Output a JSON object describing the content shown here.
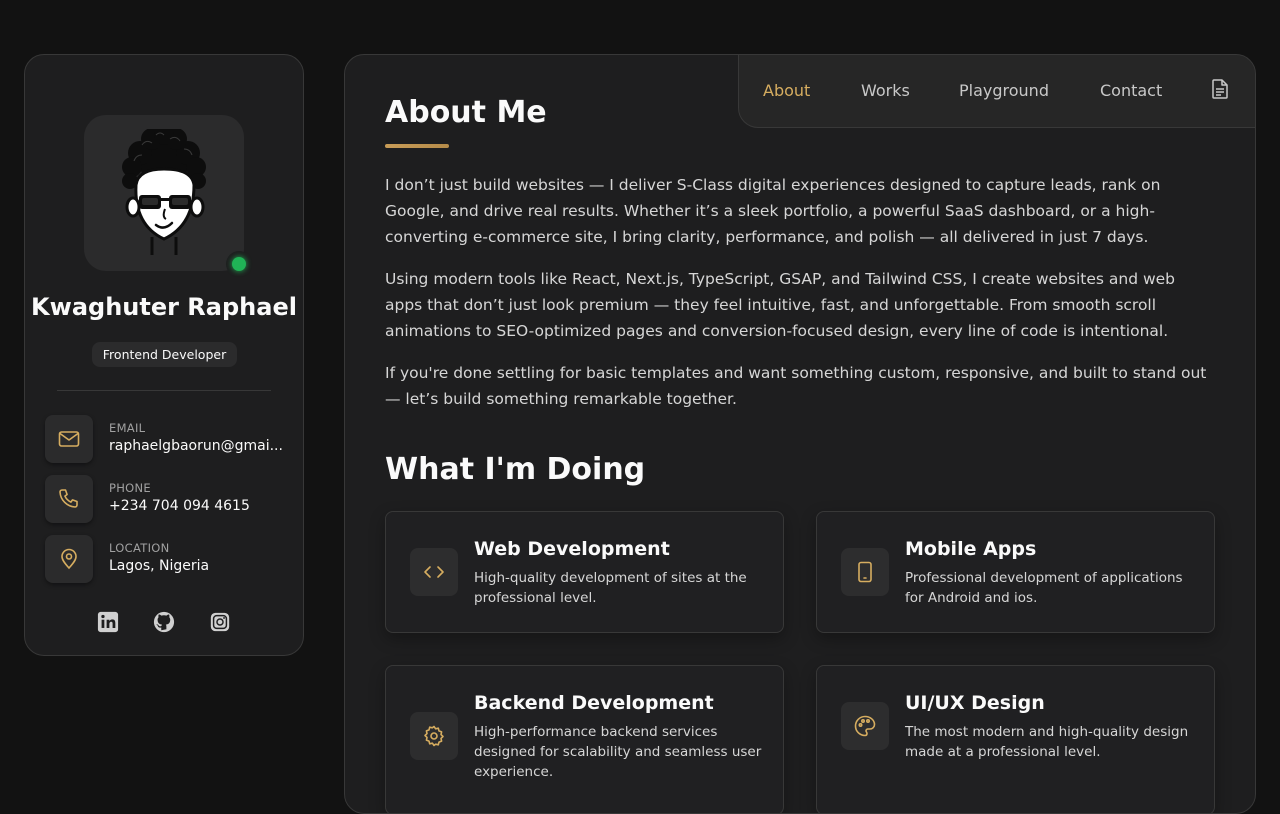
{
  "profile": {
    "name": "Kwaghuter Raphael",
    "role": "Frontend Developer",
    "status_color": "#20b356"
  },
  "contacts": [
    {
      "icon": "mail-icon",
      "label": "EMAIL",
      "value": "raphaelgbaorun@gmai..."
    },
    {
      "icon": "phone-icon",
      "label": "PHONE",
      "value": "+234 704 094 4615"
    },
    {
      "icon": "location-pin-icon",
      "label": "LOCATION",
      "value": "Lagos, Nigeria"
    }
  ],
  "socials": [
    "linkedin-icon",
    "github-icon",
    "instagram-icon"
  ],
  "nav": {
    "items": [
      "About",
      "Works",
      "Playground",
      "Contact"
    ],
    "active": "About",
    "extra_icon": "document-icon"
  },
  "about": {
    "title": "About Me",
    "paragraphs": [
      "I don’t just build websites — I deliver S-Class digital experiences designed to capture leads, rank on Google, and drive real results. Whether it’s a sleek portfolio, a powerful SaaS dashboard, or a high-converting e-commerce site, I bring clarity, performance, and polish — all delivered in just 7 days.",
      "Using modern tools like React, Next.js, TypeScript, GSAP, and Tailwind CSS, I create websites and web apps that don’t just look premium — they feel intuitive, fast, and unforgettable. From smooth scroll animations to SEO-optimized pages and conversion-focused design, every line of code is intentional.",
      "If you're done settling for basic templates and want something custom, responsive, and built to stand out — let’s build something remarkable together."
    ]
  },
  "doing": {
    "title": "What I'm Doing",
    "services": [
      {
        "icon": "code-icon",
        "title": "Web Development",
        "desc": "High-quality development of sites at the professional level."
      },
      {
        "icon": "mobile-icon",
        "title": "Mobile Apps",
        "desc": "Professional development of applications for Android and ios."
      },
      {
        "icon": "gear-icon",
        "title": "Backend Development",
        "desc": "High-performance backend services designed for scalability and seamless user experience."
      },
      {
        "icon": "palette-icon",
        "title": "UI/UX Design",
        "desc": "The most modern and high-quality design made at a professional level."
      }
    ]
  },
  "colors": {
    "accent": "#d6ad60",
    "background": "#121212",
    "panel": "#1e1e1f",
    "online": "#20b356"
  }
}
